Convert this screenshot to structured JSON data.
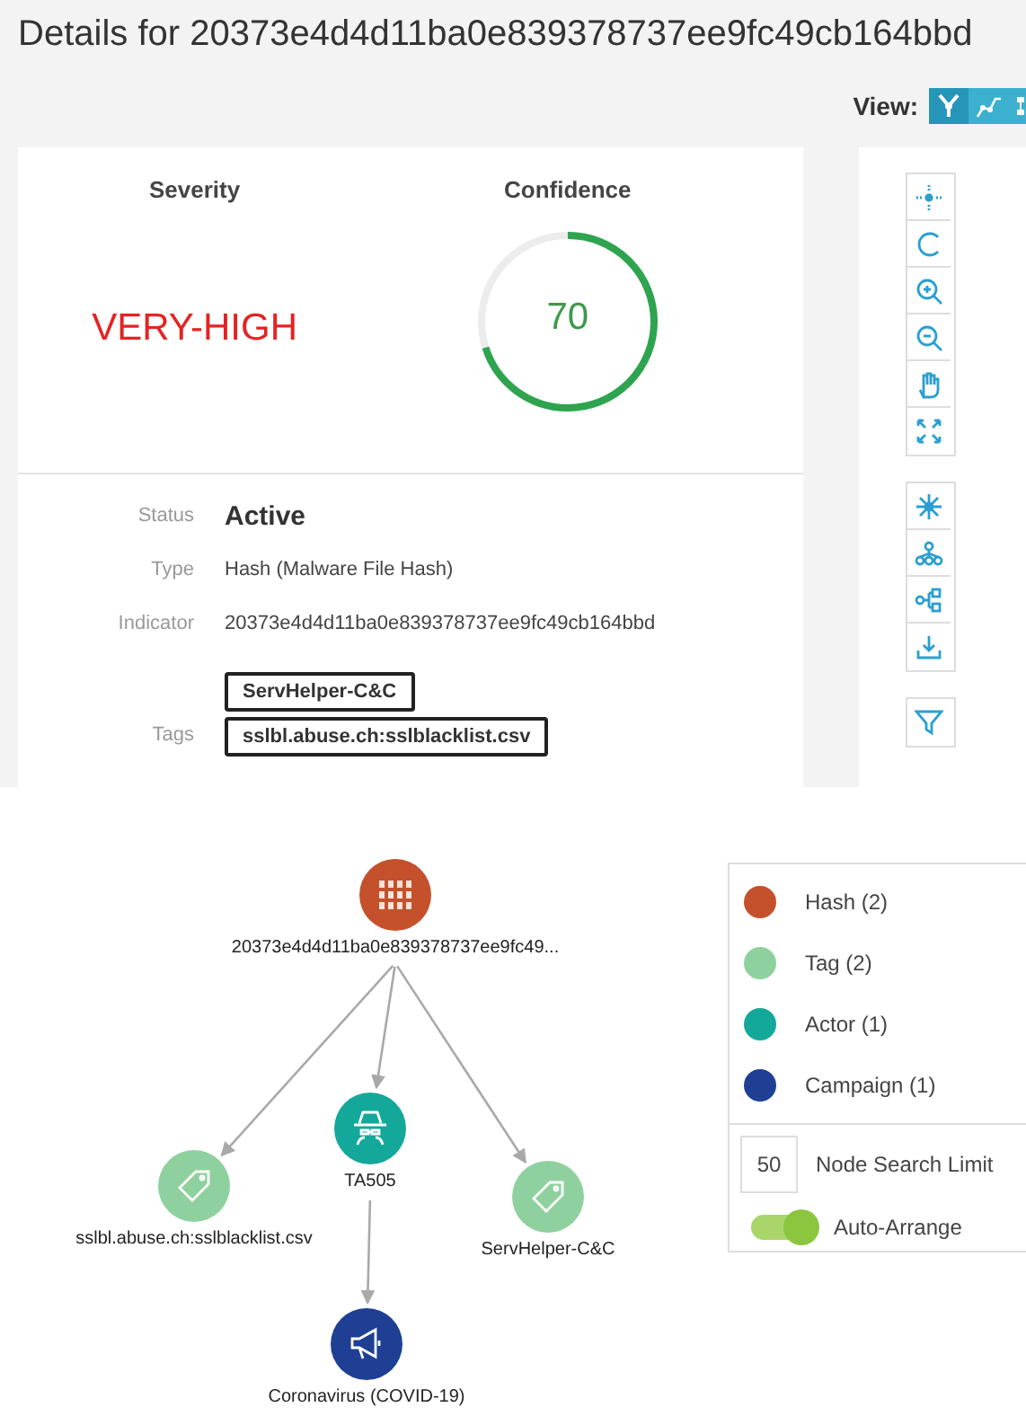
{
  "title": "Details for 20373e4d4d11ba0e839378737ee9fc49cb164bbd",
  "view": {
    "label": "View:",
    "modes": [
      {
        "selected": true
      },
      {
        "selected": false
      },
      {
        "selected": false
      }
    ]
  },
  "severity": {
    "label": "Severity",
    "value": "VERY-HIGH"
  },
  "confidence": {
    "label": "Confidence",
    "value": "70",
    "level": 0.7
  },
  "fields": [
    {
      "label": "Status",
      "value": "Active",
      "kind": "status"
    },
    {
      "label": "Type",
      "value": "Hash (Malware File Hash)",
      "kind": "text"
    },
    {
      "label": "Indicator",
      "value": "20373e4d4d11ba0e839378737ee9fc49cb164bbd",
      "kind": "text"
    }
  ],
  "tags": {
    "label": "Tags",
    "items": [
      "ServHelper-C&C",
      "sslbl.abuse.ch:sslblacklist.csv"
    ]
  },
  "graph": {
    "root": {
      "kind": "hash",
      "label": "20373e4d4d11ba0e839378737ee9fc49...",
      "children": [
        {
          "kind": "tag",
          "label": "sslbl.abuse.ch:sslblacklist.csv"
        },
        {
          "kind": "actor",
          "label": "TA505",
          "children": [
            {
              "kind": "campaign",
              "label": "Coronavirus (COVID-19)"
            }
          ]
        },
        {
          "kind": "tag",
          "label": "ServHelper-C&C"
        }
      ]
    }
  },
  "legend": {
    "items": [
      {
        "kind": "hash",
        "label": "Hash (2)",
        "color": "#c4512b"
      },
      {
        "kind": "tag",
        "label": "Tag (2)",
        "color": "#8fd19e"
      },
      {
        "kind": "actor",
        "label": "Actor (1)",
        "color": "#14a89a"
      },
      {
        "kind": "campaign",
        "label": "Campaign (1)",
        "color": "#1e3f94"
      }
    ],
    "search_limit": {
      "value": "50",
      "label": "Node Search Limit"
    },
    "auto_arrange": {
      "label": "Auto-Arrange",
      "on": true
    }
  }
}
